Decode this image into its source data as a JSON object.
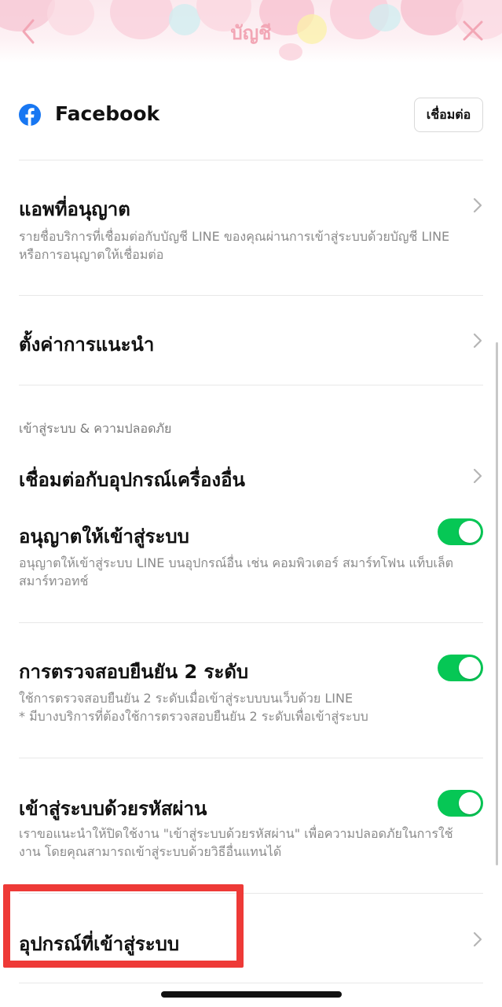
{
  "header": {
    "title": "บัญชี",
    "back_icon": "chevron-left-icon",
    "close_icon": "close-icon",
    "title_color": "#f2a6b5"
  },
  "facebook": {
    "name": "Facebook",
    "icon": "facebook-icon",
    "connect_label": "เชื่อมต่อ"
  },
  "authorized_apps": {
    "title": "แอพที่อนุญาต",
    "description": "รายชื่อบริการที่เชื่อมต่อกับบัญชี LINE ของคุณผ่านการเข้าสู่ระบบด้วยบัญชี LINE หรือการอนุญาตให้เชื่อมต่อ"
  },
  "recommendation_settings": {
    "title": "ตั้งค่าการแนะนำ"
  },
  "login_security": {
    "section_label": "เข้าสู่ระบบ & ความปลอดภัย",
    "connect_other_device": {
      "title": "เชื่อมต่อกับอุปกรณ์เครื่องอื่น"
    },
    "allow_login": {
      "title": "อนุญาตให้เข้าสู่ระบบ",
      "description": "อนุญาตให้เข้าสู่ระบบ LINE บนอุปกรณ์อื่น เช่น คอมพิวเตอร์ สมาร์ทโฟน แท็บเล็ต สมาร์ทวอทช์",
      "enabled": true
    },
    "two_step": {
      "title": "การตรวจสอบยืนยัน 2 ระดับ",
      "description_line1": "ใช้การตรวจสอบยืนยัน 2 ระดับเมื่อเข้าสู่ระบบบนเว็บด้วย LINE",
      "description_line2": "* มีบางบริการที่ต้องใช้การตรวจสอบยืนยัน 2 ระดับเพื่อเข้าสู่ระบบ",
      "enabled": true
    },
    "password_login": {
      "title": "เข้าสู่ระบบด้วยรหัสผ่าน",
      "description": "เราขอแนะนำให้ปิดใช้งาน \"เข้าสู่ระบบด้วยรหัสผ่าน\" เพื่อความปลอดภัยในการใช้งาน โดยคุณสามารถเข้าสู่ระบบด้วยวิธีอื่นแทนได้",
      "enabled": true
    },
    "logged_in_devices": {
      "title": "อุปกรณ์ที่เข้าสู่ระบบ"
    }
  },
  "colors": {
    "toggle_on": "#06c755",
    "highlight": "#ee3a37",
    "facebook_blue": "#1877f2"
  }
}
